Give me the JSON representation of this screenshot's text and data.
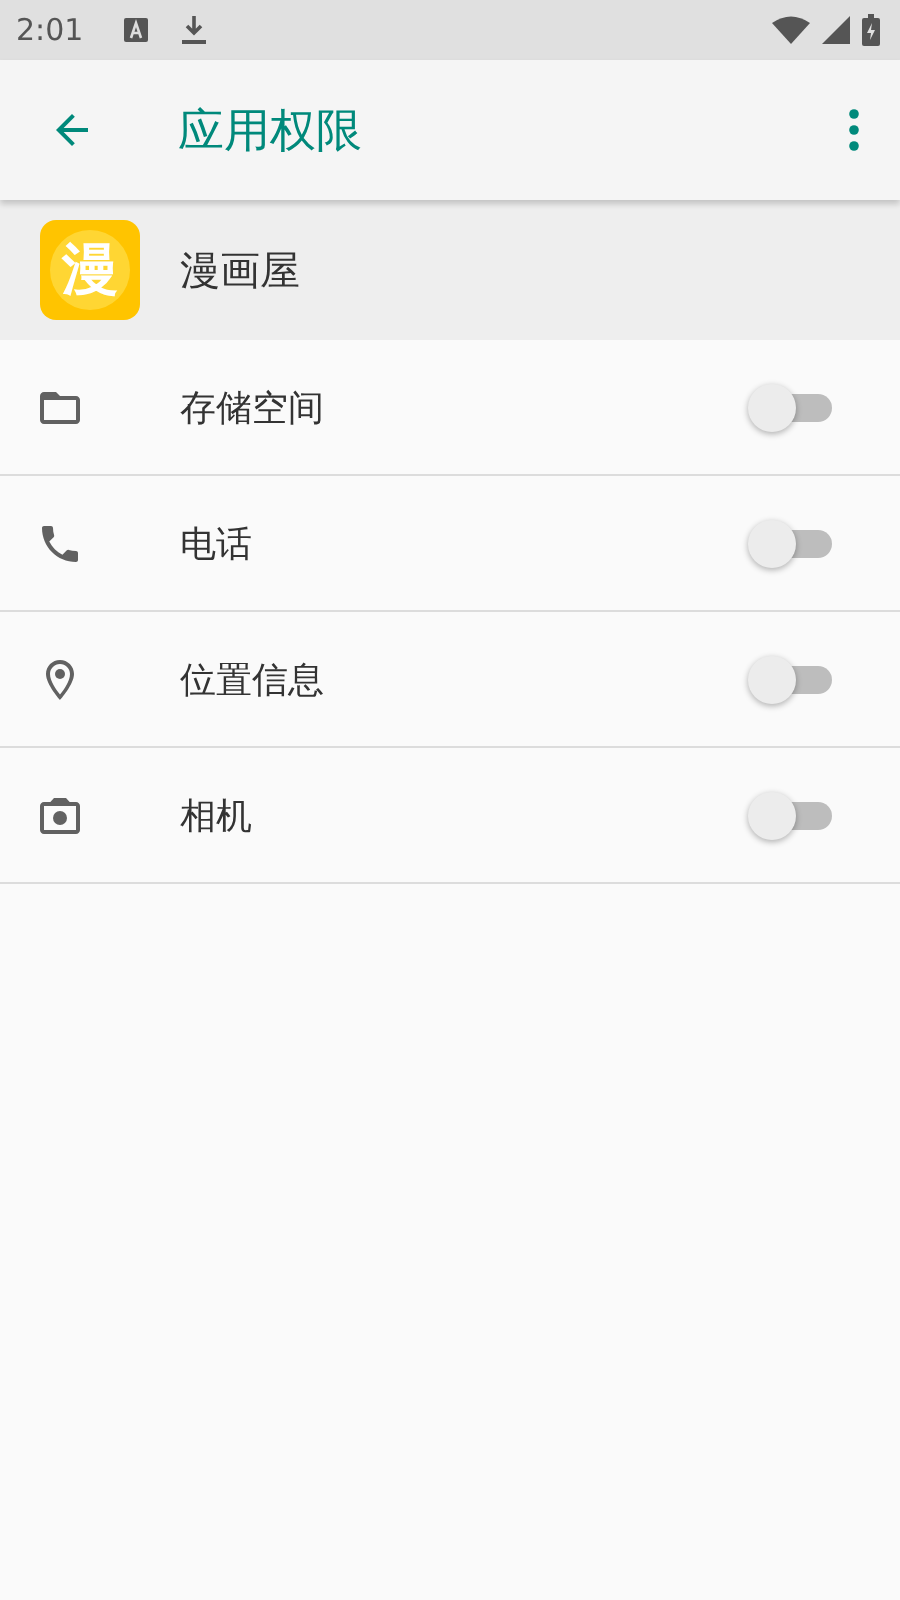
{
  "status_bar": {
    "time": "2:01"
  },
  "toolbar": {
    "title": "应用权限"
  },
  "app": {
    "name": "漫画屋",
    "icon_glyph": "漫"
  },
  "permissions": [
    {
      "kind": "storage",
      "label": "存储空间",
      "on": false
    },
    {
      "kind": "phone",
      "label": "电话",
      "on": false
    },
    {
      "kind": "location",
      "label": "位置信息",
      "on": false
    },
    {
      "kind": "camera",
      "label": "相机",
      "on": false
    }
  ]
}
